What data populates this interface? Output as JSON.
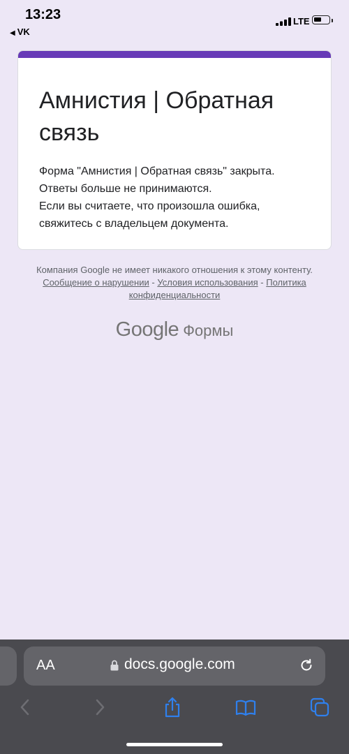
{
  "status_bar": {
    "time": "13:23",
    "back_app": "VK",
    "network": "LTE",
    "icons": [
      "signal-icon",
      "battery-icon"
    ]
  },
  "form": {
    "accent_color": "#673ab7",
    "title_line1": "Амнистия | Обратная",
    "title_line2": "связь",
    "message_lines": [
      "Форма \"Амнистия | Обратная связь\" закрыта.",
      "Ответы больше не принимаются.",
      "Если вы считаете, что произошла ошибка,",
      "свяжитесь с владельцем документа."
    ]
  },
  "footer": {
    "disclaimer_prefix": "Компания Google не имеет никакого отношения к этому контенту.",
    "link_report": "Сообщение о нарушении",
    "separator": "-",
    "link_terms": "Условия использования",
    "link_privacy": "Политика конфиденциальности",
    "brand_google": "Google",
    "brand_forms": "Формы"
  },
  "browser": {
    "text_size_button": "AA",
    "url": "docs.google.com",
    "icons": [
      "lock-icon",
      "reload-icon",
      "back-icon",
      "forward-icon",
      "share-icon",
      "bookmarks-icon",
      "tabs-icon"
    ]
  },
  "colors": {
    "page_background": "#ede7f6",
    "browser_bar": "#4a4a4f",
    "ios_blue": "#2f80ed"
  }
}
